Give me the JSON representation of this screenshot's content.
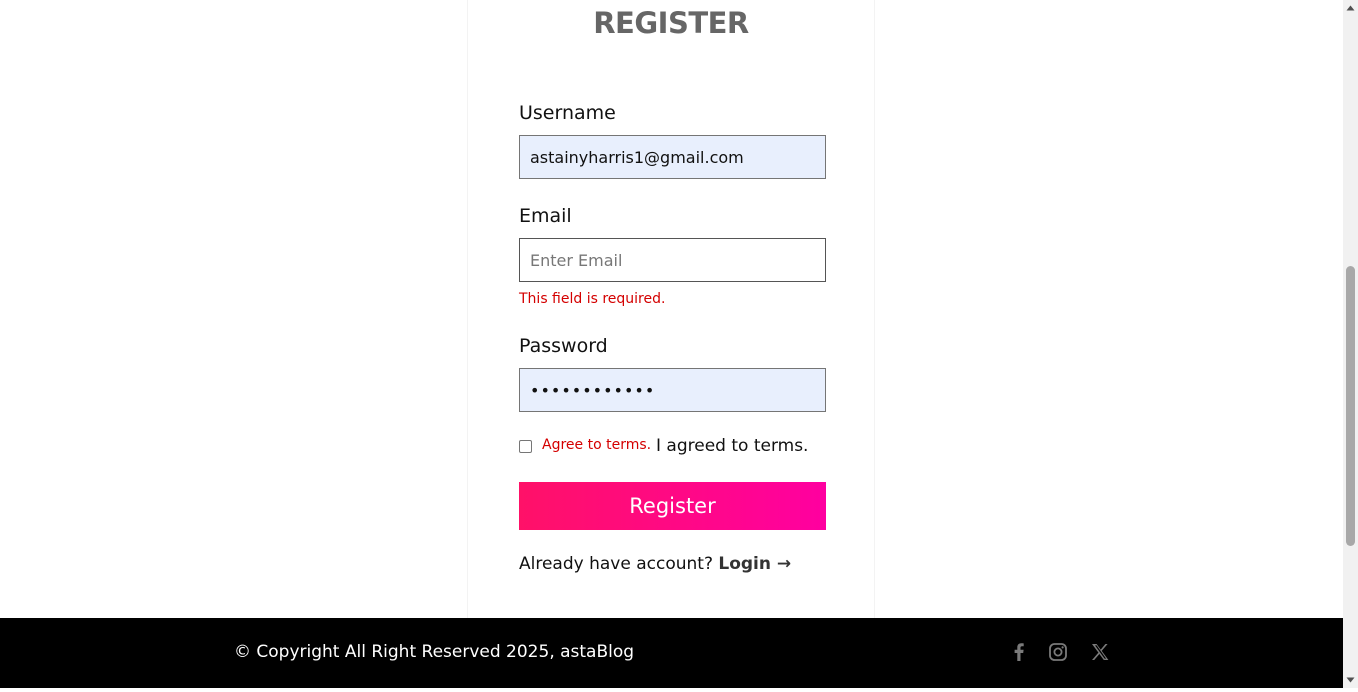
{
  "page": {
    "title": "REGISTER"
  },
  "form": {
    "username": {
      "label": "Username",
      "value": "astainyharris1@gmail.com"
    },
    "email": {
      "label": "Email",
      "value": "",
      "placeholder": "Enter Email",
      "error": "This field is required."
    },
    "password": {
      "label": "Password",
      "value": "••••••••••••"
    },
    "terms": {
      "checked": false,
      "error": "Agree to terms.",
      "label": "I agreed to terms."
    },
    "submit_label": "Register",
    "login_prompt": "Already have account?",
    "login_link": "Login →"
  },
  "footer": {
    "copyright": "© Copyright All Right Reserved 2025, astaBlog",
    "social": [
      "facebook-icon",
      "instagram-icon",
      "x-icon"
    ]
  },
  "colors": {
    "accent_start": "#ff1168",
    "accent_end": "#ff00a0",
    "error": "#d40000",
    "autofill": "#e8effd",
    "footer_bg": "#000000"
  }
}
